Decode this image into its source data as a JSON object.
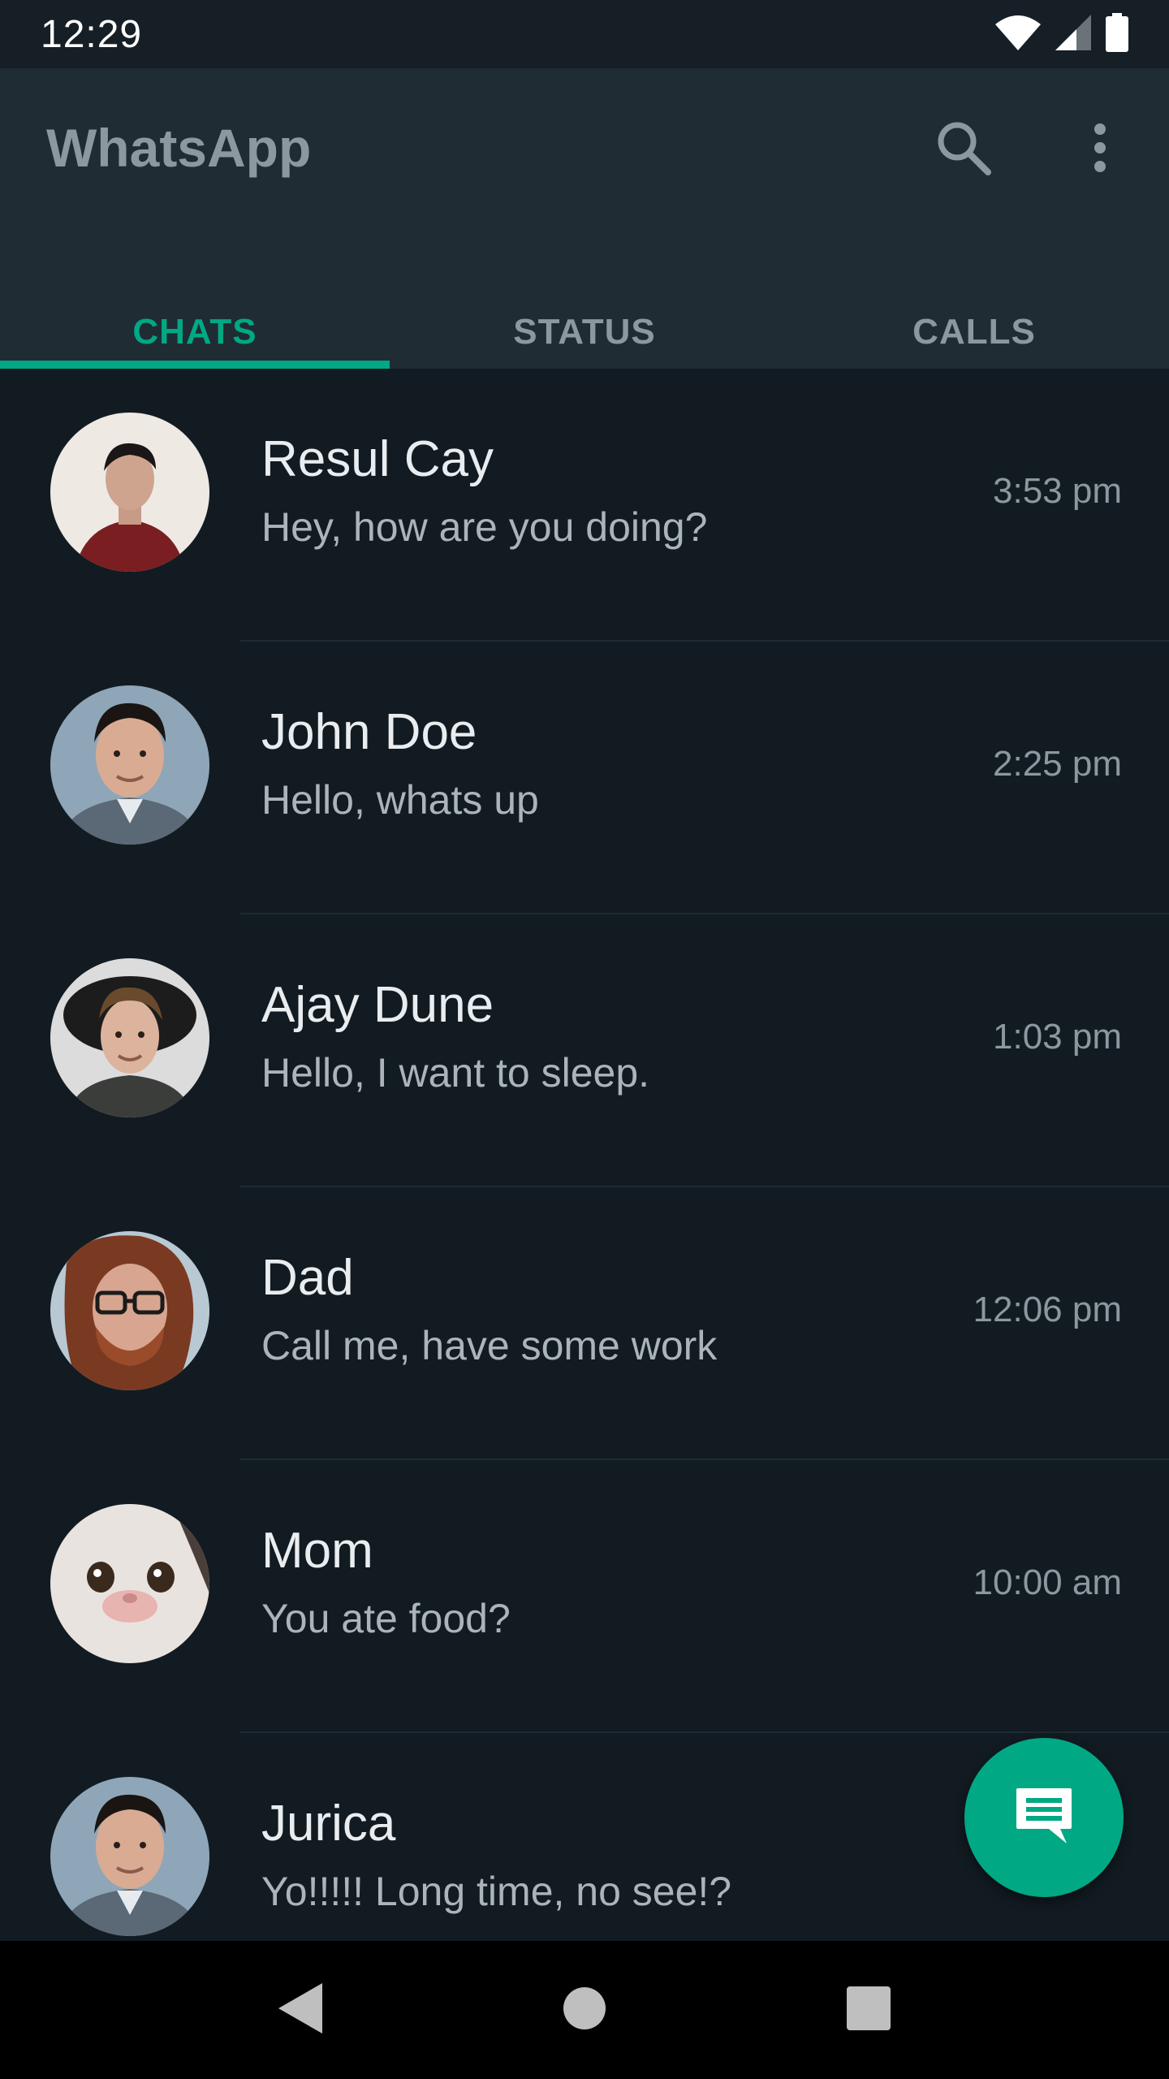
{
  "status_bar": {
    "time": "12:29"
  },
  "app_bar": {
    "title": "WhatsApp",
    "search_icon": "search-icon",
    "menu_icon": "more-vert-icon"
  },
  "tabs": [
    {
      "label": "CHATS",
      "active": true
    },
    {
      "label": "STATUS",
      "active": false
    },
    {
      "label": "CALLS",
      "active": false
    }
  ],
  "chats": [
    {
      "name": "Resul Cay",
      "message": "Hey, how are you doing?",
      "time": "3:53 pm"
    },
    {
      "name": "John Doe",
      "message": "Hello, whats up",
      "time": "2:25 pm"
    },
    {
      "name": "Ajay Dune",
      "message": "Hello, I want to sleep.",
      "time": "1:03 pm"
    },
    {
      "name": "Dad",
      "message": "Call me, have some work",
      "time": "12:06 pm"
    },
    {
      "name": "Mom",
      "message": "You ate food?",
      "time": "10:00 am"
    },
    {
      "name": "Jurica",
      "message": "Yo!!!!! Long time, no see!?",
      "time": ""
    }
  ],
  "fab": {
    "icon": "message-icon"
  },
  "colors": {
    "accent": "#00a884",
    "background": "#121b22",
    "app_bar": "#1f2c34"
  }
}
